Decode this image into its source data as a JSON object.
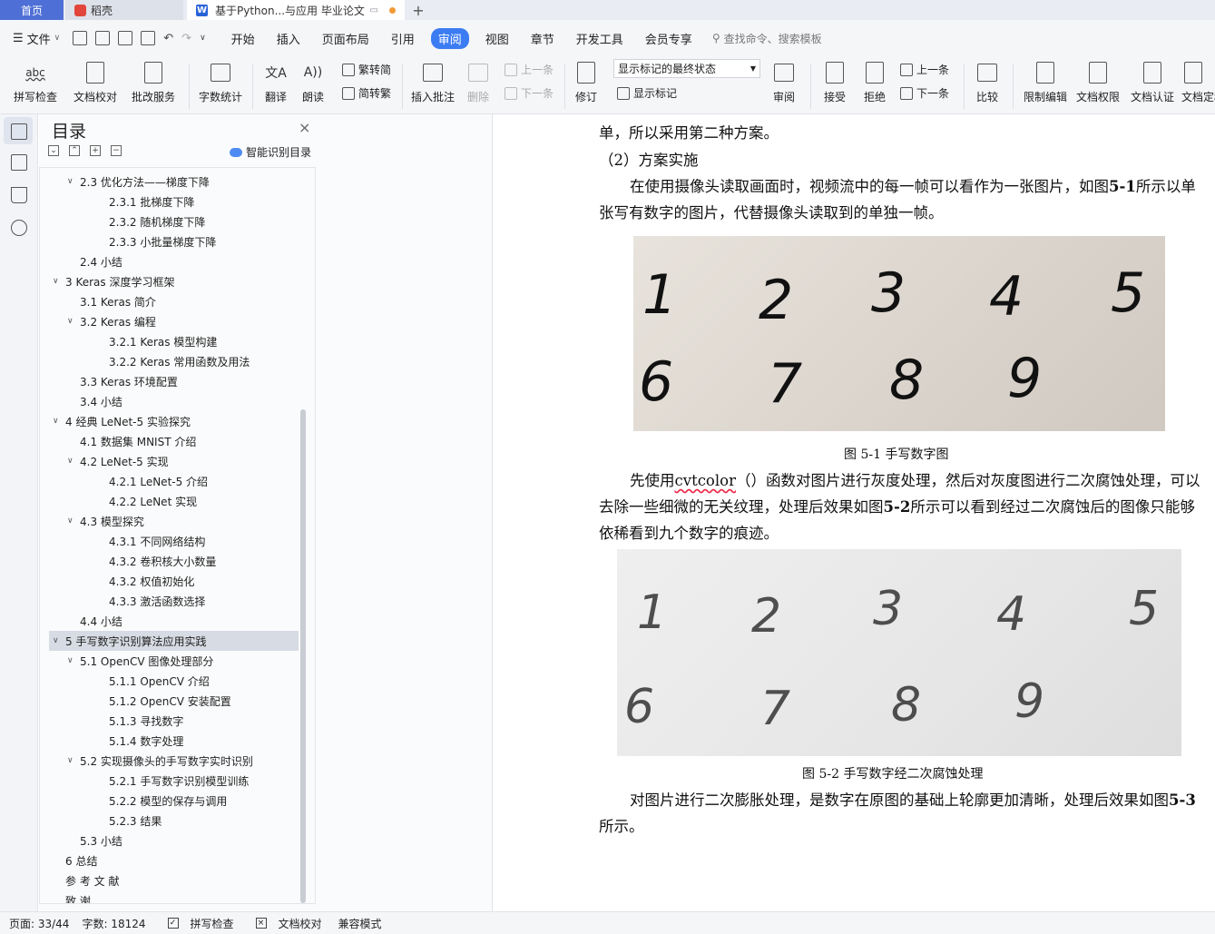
{
  "tabs": {
    "home": "首页",
    "daoke": "稻壳",
    "doc": "基于Python...与应用 毕业论文",
    "doc_logo": "W",
    "new_tab": "+"
  },
  "menubar": {
    "file": "文件",
    "items": [
      "开始",
      "插入",
      "页面布局",
      "引用",
      "审阅",
      "视图",
      "章节",
      "开发工具",
      "会员专享"
    ],
    "active": "审阅",
    "search_placeholder": "查找命令、搜索模板"
  },
  "ribbon": {
    "spell_check": "拼写检查",
    "spell_icon": "abc",
    "doc_proof": "文档校对",
    "batch_service": "批改服务",
    "word_count": "字数统计",
    "translate": "翻译",
    "read_aloud": "朗读",
    "trad": "繁转简",
    "simp": "简转繁",
    "insert_comment": "插入批注",
    "delete": "删除",
    "prev": "上一条",
    "next": "下一条",
    "revise": "修订",
    "markup_state": "显示标记的最终状态",
    "show_markup": "显示标记",
    "review": "审阅",
    "accept": "接受",
    "reject": "拒绝",
    "prev2": "上一条",
    "next2": "下一条",
    "compare": "比较",
    "restrict_edit": "限制编辑",
    "doc_permission": "文档权限",
    "doc_cert": "文档认证",
    "doc_final": "文档定稿"
  },
  "toc": {
    "title": "目录",
    "close": "×",
    "smart_label": "智能识别目录",
    "items": [
      {
        "text": "2.3  优化方法——梯度下降",
        "level": 2,
        "arrow": "∨"
      },
      {
        "text": "2.3.1  批梯度下降",
        "level": 3,
        "arrow": ""
      },
      {
        "text": "2.3.2  随机梯度下降",
        "level": 3,
        "arrow": ""
      },
      {
        "text": "2.3.3  小批量梯度下降",
        "level": 3,
        "arrow": ""
      },
      {
        "text": "2.4  小结",
        "level": 2,
        "arrow": ""
      },
      {
        "text": "3 Keras 深度学习框架",
        "level": 1,
        "arrow": "∨"
      },
      {
        "text": "3.1 Keras 简介",
        "level": 2,
        "arrow": ""
      },
      {
        "text": "3.2 Keras 编程",
        "level": 2,
        "arrow": "∨"
      },
      {
        "text": "3.2.1 Keras 模型构建",
        "level": 3,
        "arrow": ""
      },
      {
        "text": "3.2.2 Keras 常用函数及用法",
        "level": 3,
        "arrow": ""
      },
      {
        "text": "3.3 Keras 环境配置",
        "level": 2,
        "arrow": ""
      },
      {
        "text": "3.4  小结",
        "level": 2,
        "arrow": ""
      },
      {
        "text": "4  经典 LeNet-5 实验探究",
        "level": 1,
        "arrow": "∨"
      },
      {
        "text": "4.1  数据集 MNIST 介绍",
        "level": 2,
        "arrow": ""
      },
      {
        "text": "4.2 LeNet-5 实现",
        "level": 2,
        "arrow": "∨"
      },
      {
        "text": "4.2.1 LeNet-5 介绍",
        "level": 3,
        "arrow": ""
      },
      {
        "text": "4.2.2 LeNet 实现",
        "level": 3,
        "arrow": ""
      },
      {
        "text": "4.3  模型探究",
        "level": 2,
        "arrow": "∨"
      },
      {
        "text": "4.3.1  不同网络结构",
        "level": 3,
        "arrow": ""
      },
      {
        "text": "4.3.2  卷积核大小数量",
        "level": 3,
        "arrow": ""
      },
      {
        "text": "4.3.2  权值初始化",
        "level": 3,
        "arrow": ""
      },
      {
        "text": "4.3.3  激活函数选择",
        "level": 3,
        "arrow": ""
      },
      {
        "text": "4.4  小结",
        "level": 2,
        "arrow": ""
      },
      {
        "text": "5  手写数字识别算法应用实践",
        "level": 1,
        "arrow": "∨",
        "selected": true
      },
      {
        "text": "5.1 OpenCV 图像处理部分",
        "level": 2,
        "arrow": "∨"
      },
      {
        "text": "5.1.1 OpenCV 介绍",
        "level": 3,
        "arrow": ""
      },
      {
        "text": "5.1.2 OpenCV 安装配置",
        "level": 3,
        "arrow": ""
      },
      {
        "text": "5.1.3  寻找数字",
        "level": 3,
        "arrow": ""
      },
      {
        "text": "5.1.4  数字处理",
        "level": 3,
        "arrow": ""
      },
      {
        "text": "5.2  实现摄像头的手写数字实时识别",
        "level": 2,
        "arrow": "∨"
      },
      {
        "text": "5.2.1  手写数字识别模型训练",
        "level": 3,
        "arrow": ""
      },
      {
        "text": "5.2.2  模型的保存与调用",
        "level": 3,
        "arrow": ""
      },
      {
        "text": "5.2.3  结果",
        "level": 3,
        "arrow": ""
      },
      {
        "text": "5.3 小结",
        "level": 2,
        "arrow": ""
      },
      {
        "text": "6  总结",
        "level": 1,
        "arrow": ""
      },
      {
        "text": "参 考 文 献",
        "level": 1,
        "arrow": ""
      },
      {
        "text": "致  谢",
        "level": 1,
        "arrow": ""
      }
    ]
  },
  "document": {
    "p0": "单，所以采用第二种方案。",
    "p1": "（2）方案实施",
    "p2a": "在使用摄像头读取画面时，视频流中的每一帧可以看作为一张图片，如图",
    "p2_ref": "5-1",
    "p2b": "所示以单张写有数字的图片，代替摄像头读取到的单独一帧。",
    "fig1_caption": "图 5-1  手写数字图",
    "p3a": "先使用",
    "p3_func": "cvtcolor",
    "p3b": "（）函数对图片进行灰度处理，然后对灰度图进行二次腐蚀处理，可以去除一些细微的无关纹理，处理后效果如图",
    "p3_ref": "5-2",
    "p3c": "所示可以看到经过二次腐蚀后的图像只能够依稀看到九个数字的痕迹。",
    "fig2_caption": "图 5-2  手写数字经二次腐蚀处理",
    "p4a": "对图片进行二次膨胀处理，是数字在原图的基础上轮廓更加清晰，处理后效果如图",
    "p4_ref": "5-3",
    "p4b": "所示。",
    "digits": [
      "1",
      "2",
      "3",
      "4",
      "5",
      "6",
      "7",
      "8",
      "9"
    ]
  },
  "statusbar": {
    "page": "页面: 33/44",
    "words": "字数: 18124",
    "spell": "拼写检查",
    "proof": "文档校对",
    "compat": "兼容模式"
  }
}
